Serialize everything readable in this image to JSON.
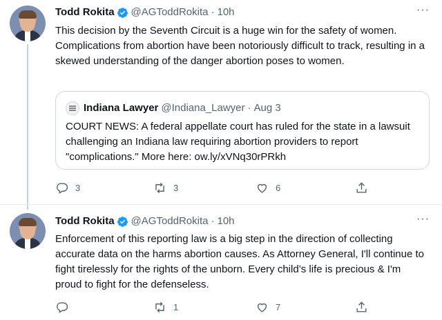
{
  "tweets": [
    {
      "author": {
        "name": "Todd Rokita",
        "handle": "@AGToddRokita",
        "separator": "·",
        "time": "10h"
      },
      "more_glyph": "···",
      "text": "This decision by the Seventh Circuit is a huge win for the safety of women. Complications from abortion have been notoriously difficult to track, resulting in a skewed understanding of the danger abortion poses to women.",
      "quote": {
        "name": "Indiana Lawyer",
        "handle": "@Indiana_Lawyer",
        "separator": "·",
        "date": "Aug 3",
        "text": "COURT NEWS: A federal appellate court has ruled for the state in a lawsuit challenging an Indiana law requiring abortion providers to report \"complications.\" More here: ow.ly/xVNq30rPRkh"
      },
      "actions": {
        "replies": "3",
        "retweets": "3",
        "likes": "6"
      }
    },
    {
      "author": {
        "name": "Todd Rokita",
        "handle": "@AGToddRokita",
        "separator": "·",
        "time": "10h"
      },
      "more_glyph": "···",
      "text": "Enforcement of this reporting law is a big step in the direction of collecting accurate data on the harms abortion causes. As Attorney General, I'll continue to fight tirelessly for the rights of the unborn. Every child’s life is precious & I'm proud to fight for the defenseless.",
      "actions": {
        "replies": "",
        "retweets": "1",
        "likes": "7"
      }
    }
  ],
  "icons": {
    "verified": "verified-badge-icon",
    "reply": "reply-icon",
    "retweet": "retweet-icon",
    "like": "heart-icon",
    "share": "share-icon"
  },
  "colors": {
    "text": "#0f1419",
    "muted": "#536471",
    "verified": "#1d9bf0",
    "border": "#cfd9de",
    "thread_line": "#c4cfd6"
  }
}
